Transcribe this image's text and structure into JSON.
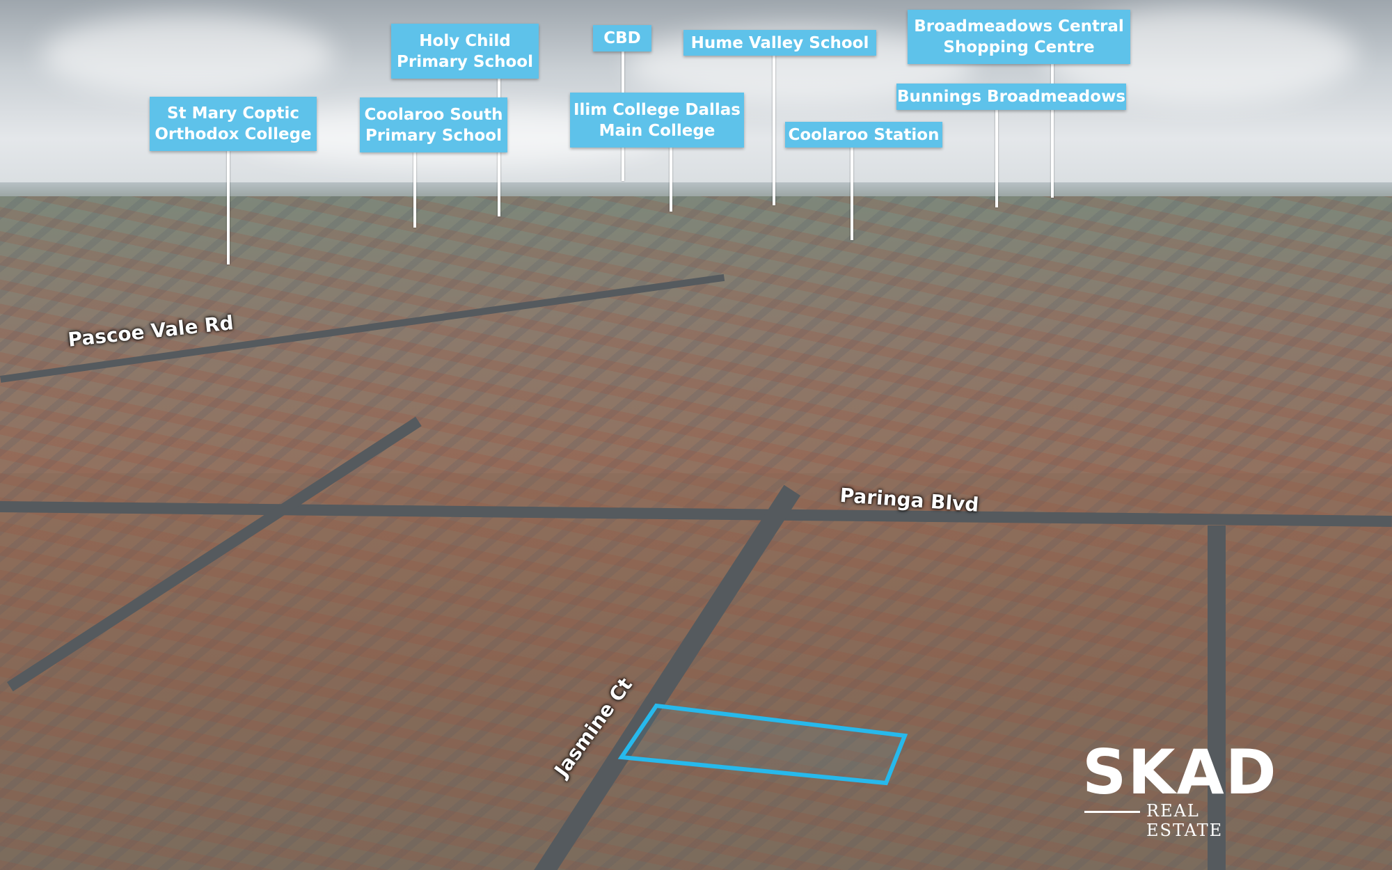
{
  "poi_labels": [
    {
      "id": "st-mary",
      "lines": [
        "St Mary Coptic",
        "Orthodox College"
      ]
    },
    {
      "id": "coolaroo-south",
      "lines": [
        "Coolaroo South",
        "Primary School"
      ]
    },
    {
      "id": "holy-child",
      "lines": [
        "Holy Child",
        "Primary School"
      ]
    },
    {
      "id": "cbd",
      "lines": [
        "CBD"
      ]
    },
    {
      "id": "ilim",
      "lines": [
        "Ilim College Dallas",
        "Main College"
      ]
    },
    {
      "id": "hume-valley",
      "lines": [
        "Hume Valley School"
      ]
    },
    {
      "id": "coolaroo-station",
      "lines": [
        "Coolaroo Station"
      ]
    },
    {
      "id": "bunnings",
      "lines": [
        "Bunnings Broadmeadows"
      ]
    },
    {
      "id": "broadmeadows",
      "lines": [
        "Broadmeadows Central",
        "Shopping Centre"
      ]
    }
  ],
  "street_labels": {
    "pascoe": "Pascoe Vale Rd",
    "paringa": "Paringa Blvd",
    "jasmine": "Jasmine Ct"
  },
  "logo": {
    "brand": "SKAD",
    "tagline": "REAL ESTATE"
  },
  "colors": {
    "label_bg": "#5ec2ea",
    "property_outline": "#27b9ec"
  }
}
